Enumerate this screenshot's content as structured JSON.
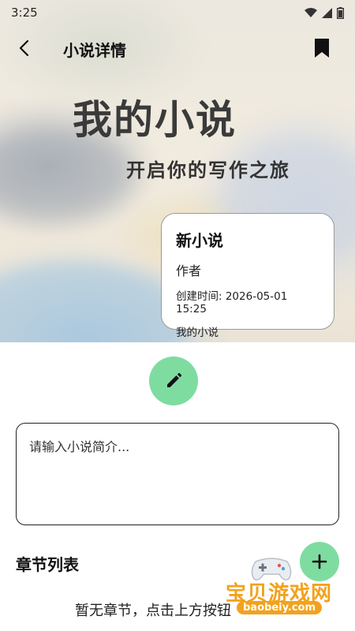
{
  "status_bar": {
    "time": "3:25"
  },
  "app_bar": {
    "title": "小说详情"
  },
  "cover": {
    "title": "我的小说",
    "subtitle": "开启你的写作之旅"
  },
  "info_card": {
    "title": "新小说",
    "author": "作者",
    "created": "创建时间: 2026-05-01 15:25",
    "description": "我的小说"
  },
  "intro": {
    "placeholder": "请输入小说简介..."
  },
  "chapters": {
    "section_title": "章节列表",
    "empty_text": "暂无章节，点击上方按钮"
  },
  "watermark": {
    "brand": "宝贝游戏网",
    "url": "baobeiy.com"
  },
  "colors": {
    "accent": "#7fdca1",
    "watermark": "#f2a21e"
  },
  "icons": [
    "back-arrow-icon",
    "bookmark-icon",
    "pencil-icon",
    "plus-icon",
    "wifi-icon",
    "signal-icon",
    "battery-icon"
  ]
}
